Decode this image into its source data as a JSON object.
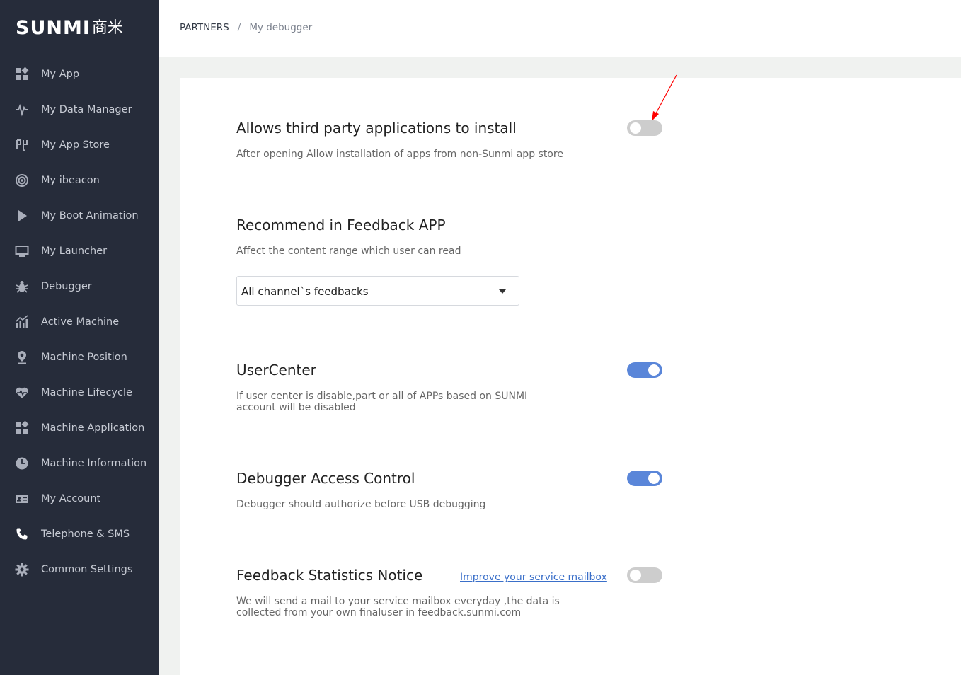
{
  "brand": {
    "logo_text": "SUNMI",
    "logo_cn": "商米"
  },
  "sidebar": {
    "items": [
      {
        "label": "My App",
        "icon": "grid-icon"
      },
      {
        "label": "My Data Manager",
        "icon": "pulse-icon"
      },
      {
        "label": "My App Store",
        "icon": "store-icon"
      },
      {
        "label": "My ibeacon",
        "icon": "beacon-icon"
      },
      {
        "label": "My Boot Animation",
        "icon": "play-icon"
      },
      {
        "label": "My Launcher",
        "icon": "monitor-icon"
      },
      {
        "label": "Debugger",
        "icon": "bug-icon"
      },
      {
        "label": "Active Machine",
        "icon": "bar-chart-icon"
      },
      {
        "label": "Machine Position",
        "icon": "location-pin-icon"
      },
      {
        "label": "Machine Lifecycle",
        "icon": "heart-pulse-icon"
      },
      {
        "label": "Machine Application",
        "icon": "grid-icon"
      },
      {
        "label": "Machine Information",
        "icon": "pie-icon"
      },
      {
        "label": "My Account",
        "icon": "id-card-icon"
      },
      {
        "label": "Telephone & SMS",
        "icon": "phone-icon"
      },
      {
        "label": "Common Settings",
        "icon": "gear-icon"
      }
    ]
  },
  "breadcrumb": {
    "root": "PARTNERS",
    "separator": "/",
    "current": "My debugger"
  },
  "settings": {
    "third_party": {
      "title": "Allows third party applications to install",
      "description": "After opening Allow installation of apps from non-Sunmi app store",
      "enabled": false
    },
    "feedback_recommend": {
      "title": "Recommend in Feedback APP",
      "description": "Affect the content range which user can read",
      "selected": "All channel`s feedbacks"
    },
    "user_center": {
      "title": "UserCenter",
      "description": "If user center is disable,part or all of APPs based on SUNMI account will be disabled",
      "enabled": true
    },
    "debugger_access": {
      "title": "Debugger Access Control",
      "description": "Debugger should authorize before USB debugging",
      "enabled": true
    },
    "feedback_statistics": {
      "title": "Feedback Statistics Notice",
      "link": "Improve your service mailbox",
      "description": "We will send a mail to your service mailbox everyday ,the data is collected from your own finaluser in feedback.sunmi.com",
      "enabled": false
    }
  },
  "colors": {
    "sidebar_bg": "#262c3a",
    "toggle_on": "#5a86d9",
    "toggle_off": "#cdcdcd",
    "link": "#3a6fc9",
    "annotation_arrow": "#ff0000"
  }
}
